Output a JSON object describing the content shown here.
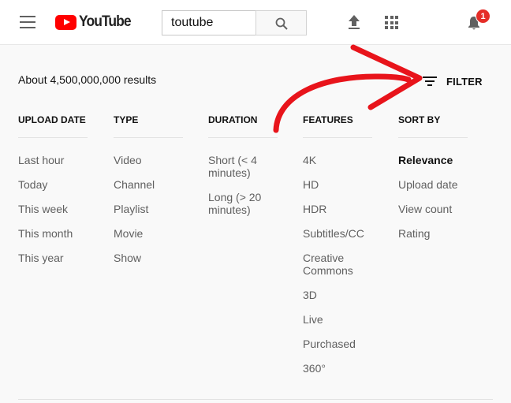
{
  "header": {
    "logo_text": "YouTube",
    "search_value": "toutube",
    "notification_count": "1"
  },
  "results": {
    "count_text": "About 4,500,000,000 results",
    "filter_label": "FILTER"
  },
  "filters": {
    "upload_date": {
      "title": "UPLOAD DATE",
      "items": [
        "Last hour",
        "Today",
        "This week",
        "This month",
        "This year"
      ]
    },
    "type": {
      "title": "TYPE",
      "items": [
        "Video",
        "Channel",
        "Playlist",
        "Movie",
        "Show"
      ]
    },
    "duration": {
      "title": "DURATION",
      "items": [
        "Short (< 4 minutes)",
        "Long (> 20 minutes)"
      ]
    },
    "features": {
      "title": "FEATURES",
      "items": [
        "4K",
        "HD",
        "HDR",
        "Subtitles/CC",
        "Creative Commons",
        "3D",
        "Live",
        "Purchased",
        "360°"
      ]
    },
    "sort_by": {
      "title": "SORT BY",
      "items": [
        "Relevance",
        "Upload date",
        "View count",
        "Rating"
      ],
      "selected": "Relevance"
    }
  },
  "colors": {
    "brand_red": "#ff0000",
    "annotation_arrow": "#e8141b",
    "badge": "#e52d27"
  },
  "icons": [
    "menu-icon",
    "youtube-logo-icon",
    "search-icon",
    "upload-icon",
    "apps-icon",
    "bell-icon",
    "filter-icon"
  ]
}
